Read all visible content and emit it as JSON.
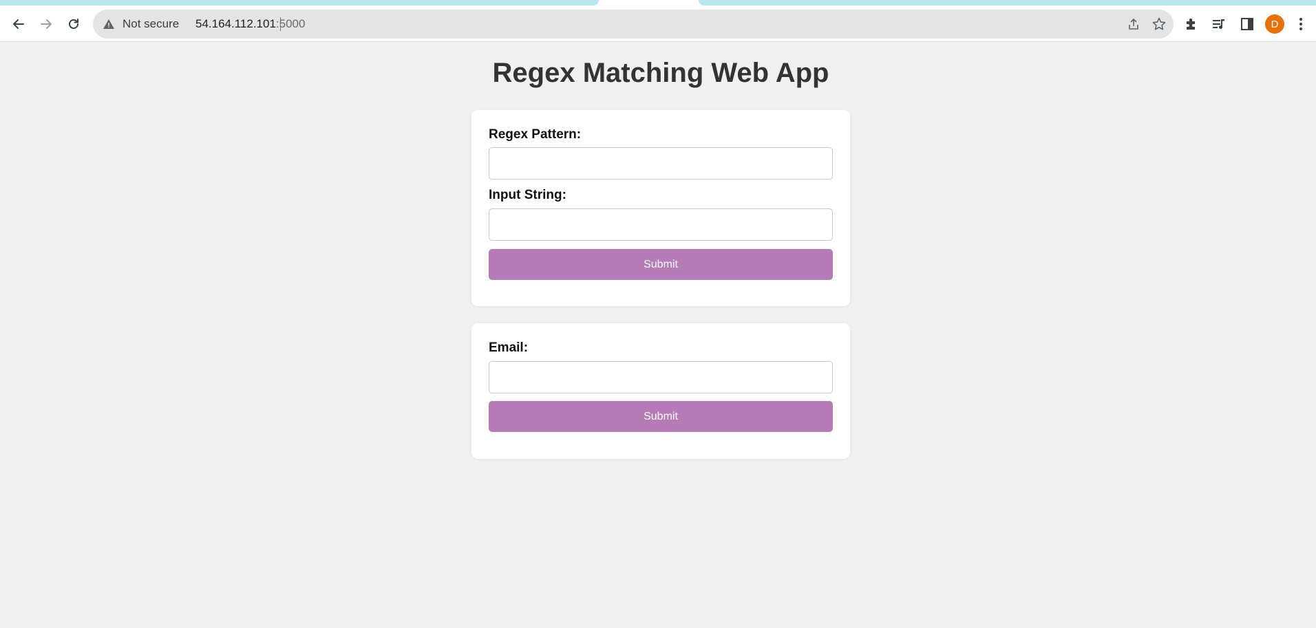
{
  "browser": {
    "security_label": "Not secure",
    "url_host": "54.164.112.101",
    "url_port": ":5000",
    "profile_initial": "D",
    "colors": {
      "tab_band": "#b6e6ee",
      "avatar": "#e8710a"
    },
    "icons": [
      "back-arrow-icon",
      "forward-arrow-icon",
      "reload-icon",
      "warning-icon",
      "share-icon",
      "star-icon",
      "extensions-icon",
      "media-control-icon",
      "side-panel-icon",
      "more-menu-icon"
    ]
  },
  "page": {
    "title": "Regex Matching Web App",
    "regex_form": {
      "pattern_label": "Regex Pattern:",
      "pattern_value": "",
      "input_label": "Input String:",
      "input_value": "",
      "submit_label": "Submit"
    },
    "email_form": {
      "email_label": "Email:",
      "email_value": "",
      "submit_label": "Submit"
    },
    "colors": {
      "button": "#b77bb7",
      "background": "#f0f0f0",
      "card": "#ffffff"
    }
  }
}
